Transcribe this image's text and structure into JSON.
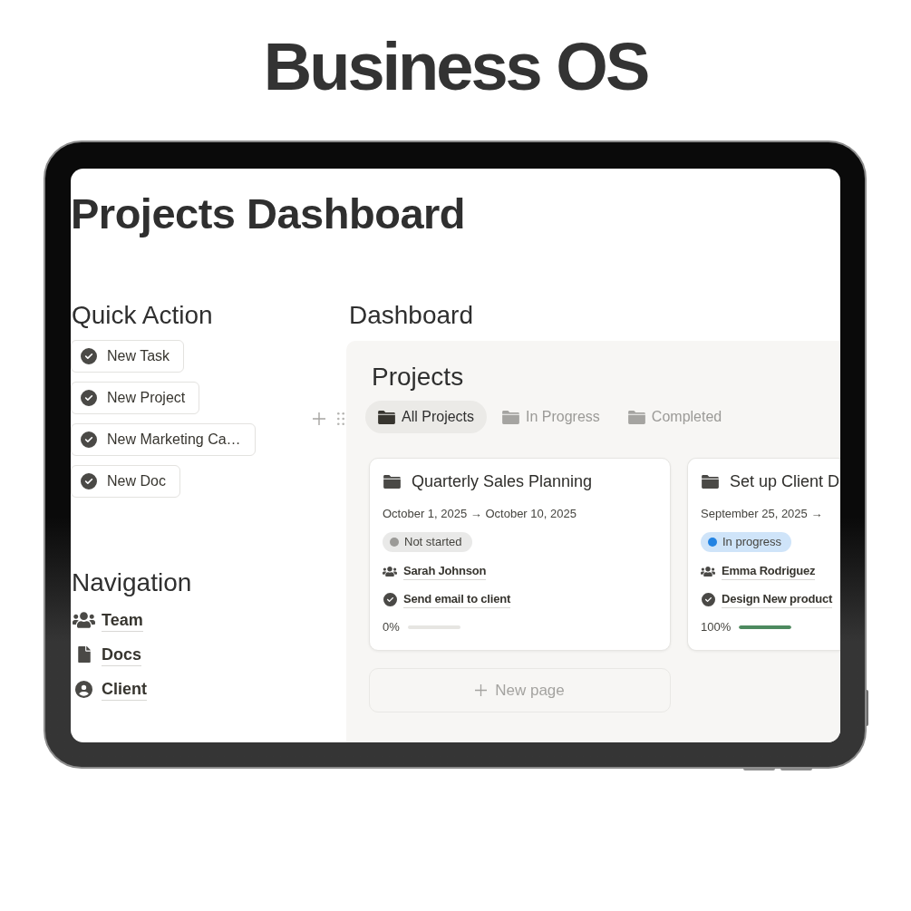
{
  "header": {
    "title": "Business OS"
  },
  "page": {
    "title": "Projects Dashboard",
    "quick_action": {
      "heading": "Quick Action",
      "buttons": [
        "New Task",
        "New Project",
        "New Marketing Ca…",
        "New Doc"
      ]
    },
    "navigation": {
      "heading": "Navigation",
      "links": [
        {
          "label": "Team",
          "kind": "team"
        },
        {
          "label": "Docs",
          "kind": "doc"
        },
        {
          "label": "Client",
          "kind": "person"
        }
      ]
    },
    "dashboard": {
      "heading": "Dashboard",
      "view_title": "Projects",
      "tabs": [
        {
          "label": "All Projects",
          "selected": true
        },
        {
          "label": "In Progress",
          "selected": false
        },
        {
          "label": "Completed",
          "selected": false
        }
      ],
      "cards": [
        {
          "title": "Quarterly Sales Planning",
          "dates": "October 1, 2025 → October 10, 2025",
          "status": {
            "label": "Not started",
            "color": "#9b9a97"
          },
          "owner": "Sarah Johnson",
          "task": "Send email to client",
          "progress": "0%",
          "level": 0
        },
        {
          "title": "Set up Client D",
          "dates": "September 25, 2025 →",
          "status": {
            "label": "In progress",
            "color": "#2383e2"
          },
          "owner": "Emma Rodriguez",
          "task": "Design New product",
          "progress": "100%",
          "level": 1
        }
      ],
      "new_page": "New page"
    }
  }
}
